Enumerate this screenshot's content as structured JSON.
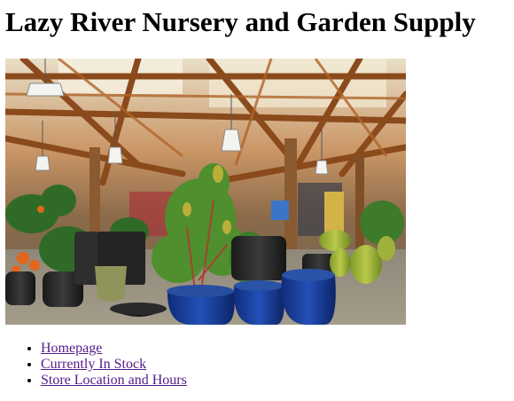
{
  "page": {
    "title": "Lazy River Nursery and Garden Supply"
  },
  "hero": {
    "icon": "nursery-photo"
  },
  "nav": {
    "items": [
      {
        "label": "Homepage"
      },
      {
        "label": "Currently In Stock"
      },
      {
        "label": "Store Location and Hours"
      }
    ],
    "link_color": "#551a8b"
  }
}
